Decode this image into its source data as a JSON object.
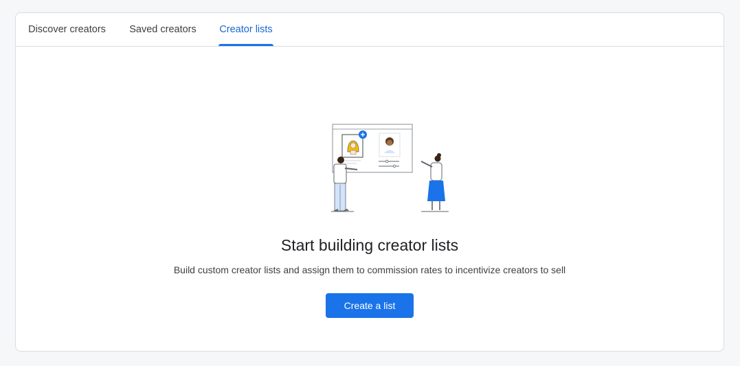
{
  "tabs": [
    {
      "label": "Discover creators",
      "active": false
    },
    {
      "label": "Saved creators",
      "active": false
    },
    {
      "label": "Creator lists",
      "active": true
    }
  ],
  "empty_state": {
    "illustration": "people-building-creator-list-illustration",
    "title": "Start building creator lists",
    "description": "Build custom creator lists and assign them to commission rates to incentivize creators to sell",
    "button_label": "Create a list"
  },
  "colors": {
    "accent": "#1a73e8",
    "active_tab_text": "#1967d2",
    "border": "#dadce0",
    "page_background": "#f6f7f9"
  }
}
